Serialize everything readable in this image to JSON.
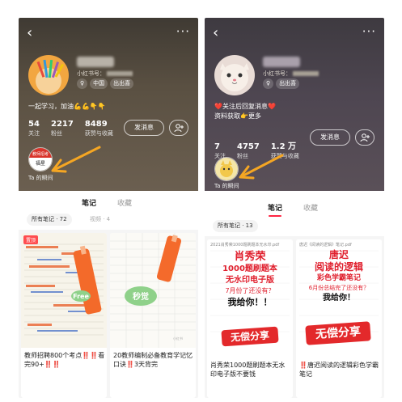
{
  "phone1": {
    "account_id_prefix": "小红书号：",
    "tags": [
      "♀",
      "中国",
      "出出喜"
    ],
    "bio": "一起学习，加油💪💪👇👇",
    "stats": [
      {
        "value": "54",
        "label": "关注"
      },
      {
        "value": "2217",
        "label": "粉丝"
      },
      {
        "value": "8489",
        "label": "获赞与收藏"
      }
    ],
    "message_button": "发消息",
    "add_friend_icon": "person-plus-icon",
    "moment_label": "Ta 的瞬间",
    "moment_avatar_text": "教师招考\n福星",
    "tabs": [
      "笔记",
      "收藏"
    ],
    "filter_all": "所有笔记 · 72",
    "filter_video": "视频 · 4",
    "notes": [
      {
        "badge": "置顶",
        "title": "教师招聘800个考点‼️‼️看完90+‼️‼️",
        "image_text": "Free"
      },
      {
        "badge": "",
        "title": "20教师编制必备教育学记忆口诀‼️3天背完",
        "image_text": "秒觉"
      }
    ]
  },
  "phone2": {
    "account_id_prefix": "小红书号：",
    "tags": [
      "♀",
      "出出喜"
    ],
    "bio": "❤️关注后回复消息❤️",
    "bio2": "资料获取👉更多",
    "stats": [
      {
        "value": "7",
        "label": "关注"
      },
      {
        "value": "4757",
        "label": "粉丝"
      },
      {
        "value": "1.2 万",
        "label": "获赞与收藏"
      }
    ],
    "message_button": "发消息",
    "add_friend_icon": "person-plus-icon",
    "moment_label": "Ta 的瞬间",
    "tabs": [
      "笔记",
      "收藏"
    ],
    "filter_all": "所有笔记 · 13",
    "notes": [
      {
        "doc_header": "2021肖秀荣1000题刷题本无水印.pdf",
        "overlay_lines": [
          "肖秀荣",
          "1000题刷题本",
          "无水印电子版",
          "7月份了还没有？",
          "我给你！！"
        ],
        "stamp": "无偿分享",
        "title": "肖秀荣1000题刷题本无水印电子版不要钱"
      },
      {
        "doc_header": "唐迟《阅读的逻辑》笔记.pdf",
        "overlay_lines": [
          "唐迟",
          "阅读的逻辑",
          "彩色学霸笔记",
          "6月份总结完了还没有？",
          "我给你！"
        ],
        "stamp": "无偿分享",
        "title": "‼️唐迟阅读的逻辑彩色学霸笔记"
      }
    ]
  },
  "colors": {
    "accent": "#ff2442",
    "arrow": "#f5a623"
  }
}
